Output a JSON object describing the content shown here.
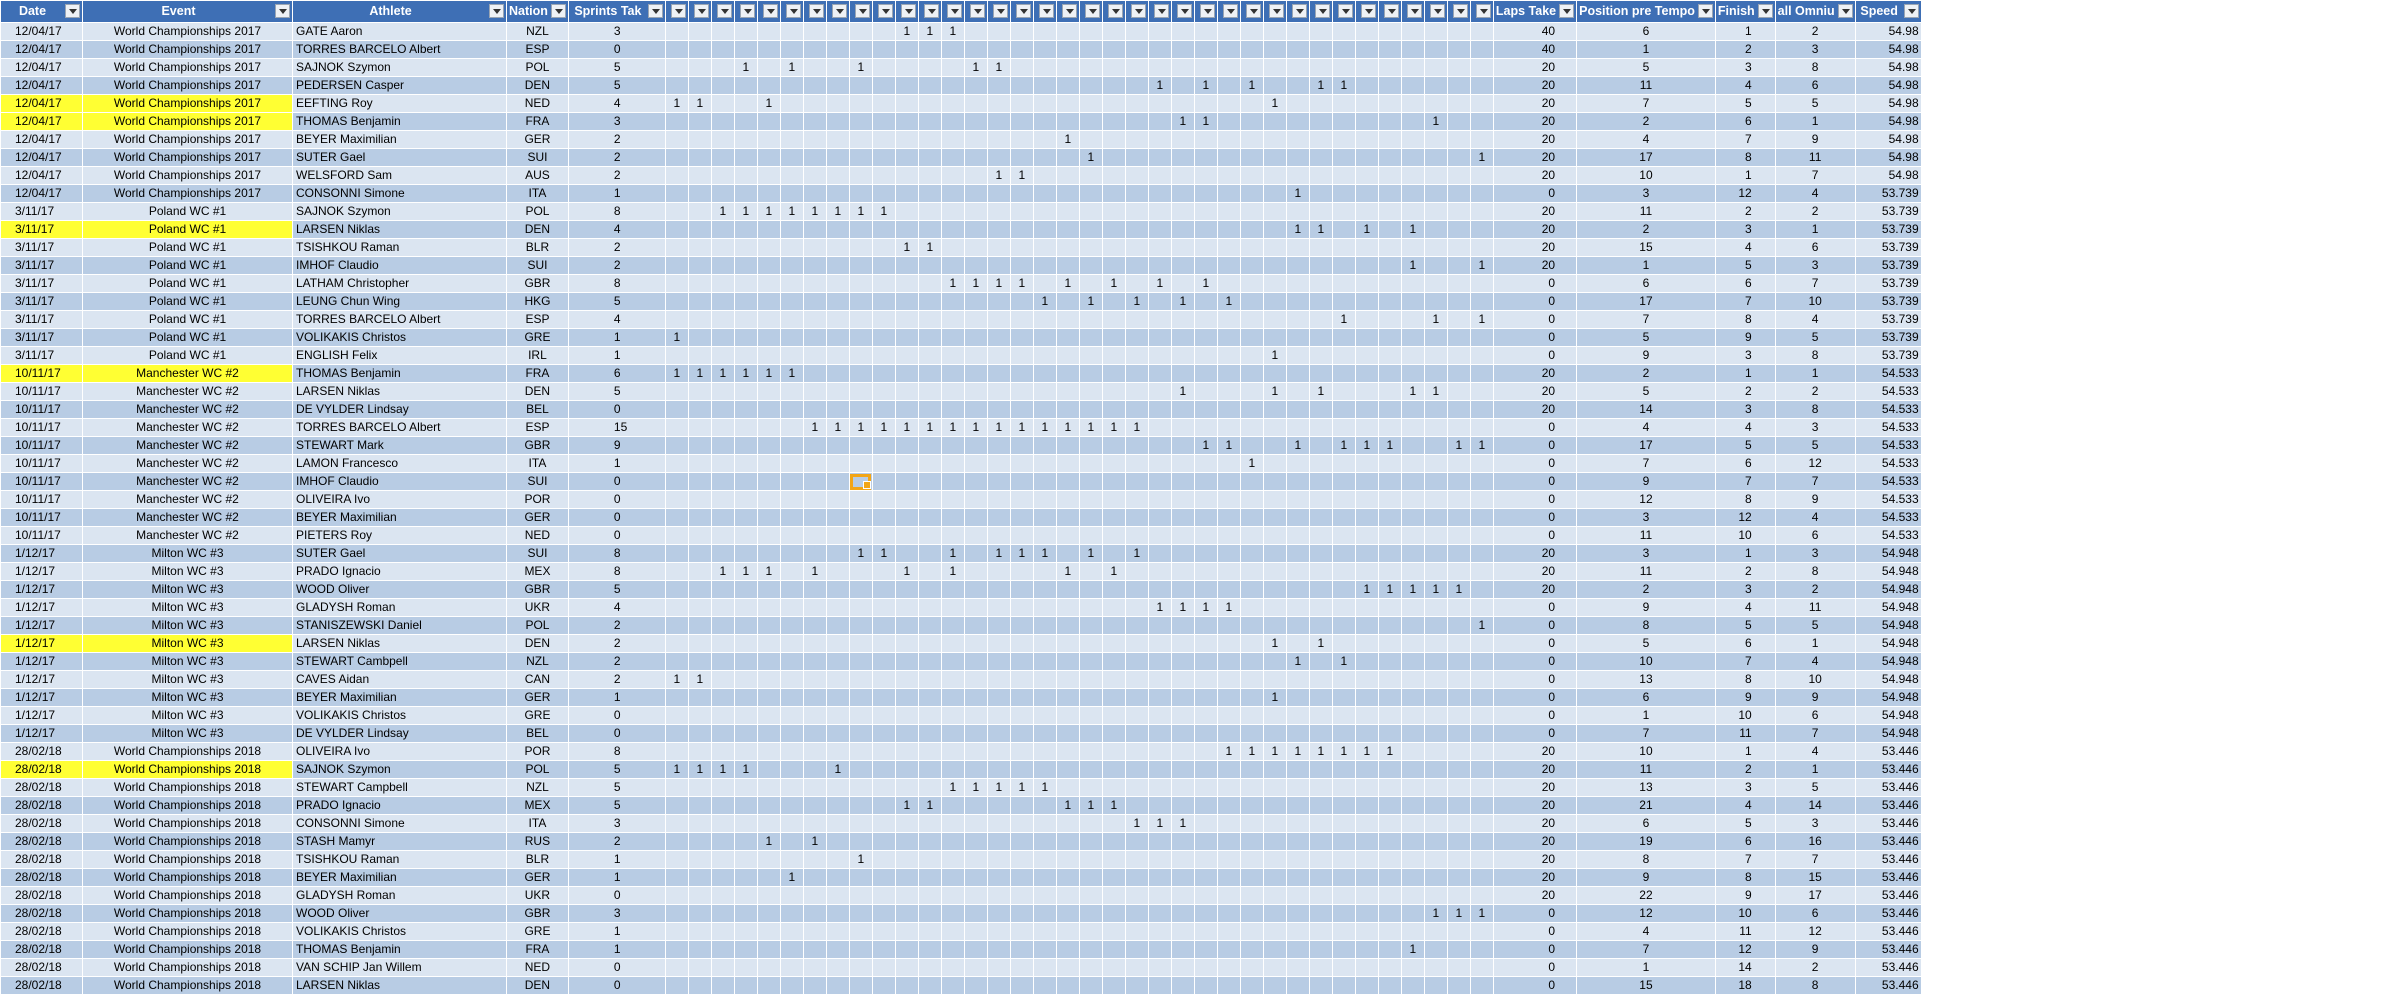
{
  "headers": {
    "date": "Date",
    "event": "Event",
    "athlete": "Athlete",
    "nation": "Nation",
    "sprints": "Sprints Tak",
    "s": [
      "",
      "",
      "",
      "",
      "",
      "",
      "",
      "",
      "",
      "",
      "",
      "",
      "",
      "",
      "",
      "",
      "",
      "",
      "",
      "",
      "",
      "",
      "",
      "",
      "",
      "",
      "",
      "",
      "",
      "",
      "",
      "",
      "",
      "",
      "",
      "",
      "",
      ""
    ],
    "laps": "Laps Take",
    "position": "Position pre Tempo",
    "finish": "Finish",
    "omnium": "all Omniu",
    "speed": "Speed"
  },
  "highlight_color": "#ffff33",
  "header_color": "#3e6fb5",
  "selected_cell": {
    "row": 25,
    "sprint_col": 8
  },
  "rows": [
    {
      "date": "12/04/17",
      "event": "World Championships 2017",
      "athlete": "GATE Aaron",
      "nation": "NZL",
      "sprints": "3",
      "s": [
        10,
        11,
        12
      ],
      "laps": "40",
      "pos": "6",
      "fin": "1",
      "omn": "2",
      "speed": "54.98"
    },
    {
      "date": "12/04/17",
      "event": "World Championships 2017",
      "athlete": "TORRES BARCELO Albert",
      "nation": "ESP",
      "sprints": "0",
      "s": [],
      "laps": "40",
      "pos": "1",
      "fin": "2",
      "omn": "3",
      "speed": "54.98"
    },
    {
      "date": "12/04/17",
      "event": "World Championships 2017",
      "athlete": "SAJNOK Szymon",
      "nation": "POL",
      "sprints": "5",
      "s": [
        3,
        5,
        8,
        13,
        14
      ],
      "laps": "20",
      "pos": "5",
      "fin": "3",
      "omn": "8",
      "speed": "54.98"
    },
    {
      "date": "12/04/17",
      "event": "World Championships 2017",
      "athlete": "PEDERSEN Casper",
      "nation": "DEN",
      "sprints": "5",
      "s": [
        21,
        23,
        25,
        28,
        29
      ],
      "laps": "20",
      "pos": "11",
      "fin": "4",
      "omn": "6",
      "speed": "54.98"
    },
    {
      "date": "12/04/17",
      "event": "World Championships 2017",
      "athlete": "EEFTING Roy",
      "nation": "NED",
      "sprints": "4",
      "s": [
        0,
        1,
        4,
        26
      ],
      "laps": "20",
      "pos": "7",
      "fin": "5",
      "omn": "5",
      "speed": "54.98",
      "hl": true
    },
    {
      "date": "12/04/17",
      "event": "World Championships 2017",
      "athlete": "THOMAS Benjamin",
      "nation": "FRA",
      "sprints": "3",
      "s": [
        22,
        23,
        33
      ],
      "laps": "20",
      "pos": "2",
      "fin": "6",
      "omn": "1",
      "speed": "54.98",
      "hl": true
    },
    {
      "date": "12/04/17",
      "event": "World Championships 2017",
      "athlete": "BEYER Maximilian",
      "nation": "GER",
      "sprints": "2",
      "s": [
        17,
        36
      ],
      "laps": "20",
      "pos": "4",
      "fin": "7",
      "omn": "9",
      "speed": "54.98"
    },
    {
      "date": "12/04/17",
      "event": "World Championships 2017",
      "athlete": "SUTER Gael",
      "nation": "SUI",
      "sprints": "2",
      "s": [
        18,
        35
      ],
      "laps": "20",
      "pos": "17",
      "fin": "8",
      "omn": "11",
      "speed": "54.98"
    },
    {
      "date": "12/04/17",
      "event": "World Championships 2017",
      "athlete": "WELSFORD Sam",
      "nation": "AUS",
      "sprints": "2",
      "s": [
        14,
        15
      ],
      "laps": "20",
      "pos": "10",
      "fin": "1",
      "omn": "7",
      "speed": "54.98"
    },
    {
      "date": "12/04/17",
      "event": "World Championships 2017",
      "athlete": "CONSONNI Simone",
      "nation": "ITA",
      "sprints": "1",
      "s": [
        27
      ],
      "laps": "0",
      "pos": "3",
      "fin": "12",
      "omn": "4",
      "speed": "53.739"
    },
    {
      "date": "3/11/17",
      "event": "Poland WC #1",
      "athlete": "SAJNOK Szymon",
      "nation": "POL",
      "sprints": "8",
      "s": [
        2,
        3,
        4,
        5,
        6,
        7,
        8,
        9
      ],
      "laps": "20",
      "pos": "11",
      "fin": "2",
      "omn": "2",
      "speed": "53.739"
    },
    {
      "date": "3/11/17",
      "event": "Poland WC #1",
      "athlete": "LARSEN Niklas",
      "nation": "DEN",
      "sprints": "4",
      "s": [
        27,
        28,
        30,
        32
      ],
      "laps": "20",
      "pos": "2",
      "fin": "3",
      "omn": "1",
      "speed": "53.739",
      "hl": true
    },
    {
      "date": "3/11/17",
      "event": "Poland WC #1",
      "athlete": "TSISHKOU Raman",
      "nation": "BLR",
      "sprints": "2",
      "s": [
        10,
        11
      ],
      "laps": "20",
      "pos": "15",
      "fin": "4",
      "omn": "6",
      "speed": "53.739"
    },
    {
      "date": "3/11/17",
      "event": "Poland WC #1",
      "athlete": "IMHOF Claudio",
      "nation": "SUI",
      "sprints": "2",
      "s": [
        32,
        35
      ],
      "laps": "20",
      "pos": "1",
      "fin": "5",
      "omn": "3",
      "speed": "53.739"
    },
    {
      "date": "3/11/17",
      "event": "Poland WC #1",
      "athlete": "LATHAM Christopher",
      "nation": "GBR",
      "sprints": "8",
      "s": [
        12,
        13,
        14,
        15,
        17,
        19,
        21,
        23
      ],
      "laps": "0",
      "pos": "6",
      "fin": "6",
      "omn": "7",
      "speed": "53.739"
    },
    {
      "date": "3/11/17",
      "event": "Poland WC #1",
      "athlete": "LEUNG Chun Wing",
      "nation": "HKG",
      "sprints": "5",
      "s": [
        16,
        18,
        20,
        22,
        24
      ],
      "laps": "0",
      "pos": "17",
      "fin": "7",
      "omn": "10",
      "speed": "53.739"
    },
    {
      "date": "3/11/17",
      "event": "Poland WC #1",
      "athlete": "TORRES BARCELO Albert",
      "nation": "ESP",
      "sprints": "4",
      "s": [
        29,
        33,
        35,
        36
      ],
      "laps": "0",
      "pos": "7",
      "fin": "8",
      "omn": "4",
      "speed": "53.739"
    },
    {
      "date": "3/11/17",
      "event": "Poland WC #1",
      "athlete": "VOLIKAKIS Christos",
      "nation": "GRE",
      "sprints": "1",
      "s": [
        0
      ],
      "laps": "0",
      "pos": "5",
      "fin": "9",
      "omn": "5",
      "speed": "53.739"
    },
    {
      "date": "3/11/17",
      "event": "Poland WC #1",
      "athlete": "ENGLISH Felix",
      "nation": "IRL",
      "sprints": "1",
      "s": [
        26
      ],
      "laps": "0",
      "pos": "9",
      "fin": "3",
      "omn": "8",
      "speed": "53.739"
    },
    {
      "date": "10/11/17",
      "event": "Manchester WC #2",
      "athlete": "THOMAS Benjamin",
      "nation": "FRA",
      "sprints": "6",
      "s": [
        0,
        1,
        2,
        3,
        4,
        5
      ],
      "laps": "20",
      "pos": "2",
      "fin": "1",
      "omn": "1",
      "speed": "54.533",
      "hl": true
    },
    {
      "date": "10/11/17",
      "event": "Manchester WC #2",
      "athlete": "LARSEN Niklas",
      "nation": "DEN",
      "sprints": "5",
      "s": [
        22,
        26,
        28,
        32,
        33
      ],
      "laps": "20",
      "pos": "5",
      "fin": "2",
      "omn": "2",
      "speed": "54.533"
    },
    {
      "date": "10/11/17",
      "event": "Manchester WC #2",
      "athlete": "DE VYLDER Lindsay",
      "nation": "BEL",
      "sprints": "0",
      "s": [],
      "laps": "20",
      "pos": "14",
      "fin": "3",
      "omn": "8",
      "speed": "54.533"
    },
    {
      "date": "10/11/17",
      "event": "Manchester WC #2",
      "athlete": "TORRES BARCELO Albert",
      "nation": "ESP",
      "sprints": "15",
      "s": [
        6,
        7,
        8,
        9,
        10,
        11,
        12,
        13,
        14,
        15,
        16,
        17,
        18,
        19,
        20
      ],
      "laps": "0",
      "pos": "4",
      "fin": "4",
      "omn": "3",
      "speed": "54.533"
    },
    {
      "date": "10/11/17",
      "event": "Manchester WC #2",
      "athlete": "STEWART Mark",
      "nation": "GBR",
      "sprints": "9",
      "s": [
        23,
        24,
        27,
        29,
        30,
        31,
        34,
        35,
        36
      ],
      "laps": "0",
      "pos": "17",
      "fin": "5",
      "omn": "5",
      "speed": "54.533"
    },
    {
      "date": "10/11/17",
      "event": "Manchester WC #2",
      "athlete": "LAMON Francesco",
      "nation": "ITA",
      "sprints": "1",
      "s": [
        25
      ],
      "laps": "0",
      "pos": "7",
      "fin": "6",
      "omn": "12",
      "speed": "54.533"
    },
    {
      "date": "10/11/17",
      "event": "Manchester WC #2",
      "athlete": "IMHOF Claudio",
      "nation": "SUI",
      "sprints": "0",
      "s": [],
      "laps": "0",
      "pos": "9",
      "fin": "7",
      "omn": "7",
      "speed": "54.533"
    },
    {
      "date": "10/11/17",
      "event": "Manchester WC #2",
      "athlete": "OLIVEIRA Ivo",
      "nation": "POR",
      "sprints": "0",
      "s": [],
      "laps": "0",
      "pos": "12",
      "fin": "8",
      "omn": "9",
      "speed": "54.533"
    },
    {
      "date": "10/11/17",
      "event": "Manchester WC #2",
      "athlete": "BEYER Maximilian",
      "nation": "GER",
      "sprints": "0",
      "s": [],
      "laps": "0",
      "pos": "3",
      "fin": "12",
      "omn": "4",
      "speed": "54.533"
    },
    {
      "date": "10/11/17",
      "event": "Manchester WC #2",
      "athlete": "PIETERS Roy",
      "nation": "NED",
      "sprints": "0",
      "s": [],
      "laps": "0",
      "pos": "11",
      "fin": "10",
      "omn": "6",
      "speed": "54.533"
    },
    {
      "date": "1/12/17",
      "event": "Milton WC #3",
      "athlete": "SUTER Gael",
      "nation": "SUI",
      "sprints": "8",
      "s": [
        8,
        9,
        12,
        14,
        15,
        16,
        18,
        20
      ],
      "laps": "20",
      "pos": "3",
      "fin": "1",
      "omn": "3",
      "speed": "54.948"
    },
    {
      "date": "1/12/17",
      "event": "Milton WC #3",
      "athlete": "PRADO Ignacio",
      "nation": "MEX",
      "sprints": "8",
      "s": [
        2,
        3,
        4,
        6,
        10,
        12,
        17,
        19
      ],
      "laps": "20",
      "pos": "11",
      "fin": "2",
      "omn": "8",
      "speed": "54.948"
    },
    {
      "date": "1/12/17",
      "event": "Milton WC #3",
      "athlete": "WOOD Oliver",
      "nation": "GBR",
      "sprints": "5",
      "s": [
        30,
        31,
        32,
        33,
        34
      ],
      "laps": "20",
      "pos": "2",
      "fin": "3",
      "omn": "2",
      "speed": "54.948"
    },
    {
      "date": "1/12/17",
      "event": "Milton WC #3",
      "athlete": "GLADYSH Roman",
      "nation": "UKR",
      "sprints": "4",
      "s": [
        21,
        22,
        23,
        24
      ],
      "laps": "0",
      "pos": "9",
      "fin": "4",
      "omn": "11",
      "speed": "54.948"
    },
    {
      "date": "1/12/17",
      "event": "Milton WC #3",
      "athlete": "STANISZEWSKI Daniel",
      "nation": "POL",
      "sprints": "2",
      "s": [
        35,
        36
      ],
      "laps": "0",
      "pos": "8",
      "fin": "5",
      "omn": "5",
      "speed": "54.948"
    },
    {
      "date": "1/12/17",
      "event": "Milton WC #3",
      "athlete": "LARSEN Niklas",
      "nation": "DEN",
      "sprints": "2",
      "s": [
        26,
        28
      ],
      "laps": "0",
      "pos": "5",
      "fin": "6",
      "omn": "1",
      "speed": "54.948",
      "hl": true
    },
    {
      "date": "1/12/17",
      "event": "Milton WC #3",
      "athlete": "STEWART Cambpell",
      "nation": "NZL",
      "sprints": "2",
      "s": [
        27,
        29
      ],
      "laps": "0",
      "pos": "10",
      "fin": "7",
      "omn": "4",
      "speed": "54.948"
    },
    {
      "date": "1/12/17",
      "event": "Milton WC #3",
      "athlete": "CAVES Aidan",
      "nation": "CAN",
      "sprints": "2",
      "s": [
        0,
        1
      ],
      "laps": "0",
      "pos": "13",
      "fin": "8",
      "omn": "10",
      "speed": "54.948"
    },
    {
      "date": "1/12/17",
      "event": "Milton WC #3",
      "athlete": "BEYER Maximilian",
      "nation": "GER",
      "sprints": "1",
      "s": [
        26
      ],
      "laps": "0",
      "pos": "6",
      "fin": "9",
      "omn": "9",
      "speed": "54.948"
    },
    {
      "date": "1/12/17",
      "event": "Milton WC #3",
      "athlete": "VOLIKAKIS Christos",
      "nation": "GRE",
      "sprints": "0",
      "s": [],
      "laps": "0",
      "pos": "1",
      "fin": "10",
      "omn": "6",
      "speed": "54.948"
    },
    {
      "date": "1/12/17",
      "event": "Milton WC #3",
      "athlete": "DE VYLDER Lindsay",
      "nation": "BEL",
      "sprints": "0",
      "s": [],
      "laps": "0",
      "pos": "7",
      "fin": "11",
      "omn": "7",
      "speed": "54.948"
    },
    {
      "date": "28/02/18",
      "event": "World Championships 2018",
      "athlete": "OLIVEIRA Ivo",
      "nation": "POR",
      "sprints": "8",
      "s": [
        24,
        25,
        26,
        27,
        28,
        29,
        30,
        31
      ],
      "laps": "20",
      "pos": "10",
      "fin": "1",
      "omn": "4",
      "speed": "53.446"
    },
    {
      "date": "28/02/18",
      "event": "World Championships 2018",
      "athlete": "SAJNOK Szymon",
      "nation": "POL",
      "sprints": "5",
      "s": [
        0,
        1,
        2,
        3,
        7
      ],
      "laps": "20",
      "pos": "11",
      "fin": "2",
      "omn": "1",
      "speed": "53.446",
      "hl": true
    },
    {
      "date": "28/02/18",
      "event": "World Championships 2018",
      "athlete": "STEWART Campbell",
      "nation": "NZL",
      "sprints": "5",
      "s": [
        12,
        13,
        14,
        15,
        16
      ],
      "laps": "20",
      "pos": "13",
      "fin": "3",
      "omn": "5",
      "speed": "53.446"
    },
    {
      "date": "28/02/18",
      "event": "World Championships 2018",
      "athlete": "PRADO Ignacio",
      "nation": "MEX",
      "sprints": "5",
      "s": [
        10,
        11,
        17,
        18,
        19
      ],
      "laps": "20",
      "pos": "21",
      "fin": "4",
      "omn": "14",
      "speed": "53.446"
    },
    {
      "date": "28/02/18",
      "event": "World Championships 2018",
      "athlete": "CONSONNI Simone",
      "nation": "ITA",
      "sprints": "3",
      "s": [
        20,
        21,
        22
      ],
      "laps": "20",
      "pos": "6",
      "fin": "5",
      "omn": "3",
      "speed": "53.446"
    },
    {
      "date": "28/02/18",
      "event": "World Championships 2018",
      "athlete": "STASH Mamyr",
      "nation": "RUS",
      "sprints": "2",
      "s": [
        4,
        6
      ],
      "laps": "20",
      "pos": "19",
      "fin": "6",
      "omn": "16",
      "speed": "53.446"
    },
    {
      "date": "28/02/18",
      "event": "World Championships 2018",
      "athlete": "TSISHKOU Raman",
      "nation": "BLR",
      "sprints": "1",
      "s": [
        8
      ],
      "laps": "20",
      "pos": "8",
      "fin": "7",
      "omn": "7",
      "speed": "53.446"
    },
    {
      "date": "28/02/18",
      "event": "World Championships 2018",
      "athlete": "BEYER Maximilian",
      "nation": "GER",
      "sprints": "1",
      "s": [
        5
      ],
      "laps": "20",
      "pos": "9",
      "fin": "8",
      "omn": "15",
      "speed": "53.446"
    },
    {
      "date": "28/02/18",
      "event": "World Championships 2018",
      "athlete": "GLADYSH Roman",
      "nation": "UKR",
      "sprints": "0",
      "s": [],
      "laps": "20",
      "pos": "22",
      "fin": "9",
      "omn": "17",
      "speed": "53.446"
    },
    {
      "date": "28/02/18",
      "event": "World Championships 2018",
      "athlete": "WOOD Oliver",
      "nation": "GBR",
      "sprints": "3",
      "s": [
        33,
        34,
        35
      ],
      "laps": "0",
      "pos": "12",
      "fin": "10",
      "omn": "6",
      "speed": "53.446"
    },
    {
      "date": "28/02/18",
      "event": "World Championships 2018",
      "athlete": "VOLIKAKIS Christos",
      "nation": "GRE",
      "sprints": "1",
      "s": [
        36
      ],
      "laps": "0",
      "pos": "4",
      "fin": "11",
      "omn": "12",
      "speed": "53.446"
    },
    {
      "date": "28/02/18",
      "event": "World Championships 2018",
      "athlete": "THOMAS Benjamin",
      "nation": "FRA",
      "sprints": "1",
      "s": [
        32
      ],
      "laps": "0",
      "pos": "7",
      "fin": "12",
      "omn": "9",
      "speed": "53.446"
    },
    {
      "date": "28/02/18",
      "event": "World Championships 2018",
      "athlete": "VAN SCHIP Jan Willem",
      "nation": "NED",
      "sprints": "0",
      "s": [],
      "laps": "0",
      "pos": "1",
      "fin": "14",
      "omn": "2",
      "speed": "53.446"
    },
    {
      "date": "28/02/18",
      "event": "World Championships 2018",
      "athlete": "LARSEN Niklas",
      "nation": "DEN",
      "sprints": "0",
      "s": [],
      "laps": "0",
      "pos": "15",
      "fin": "18",
      "omn": "8",
      "speed": "53.446"
    }
  ]
}
